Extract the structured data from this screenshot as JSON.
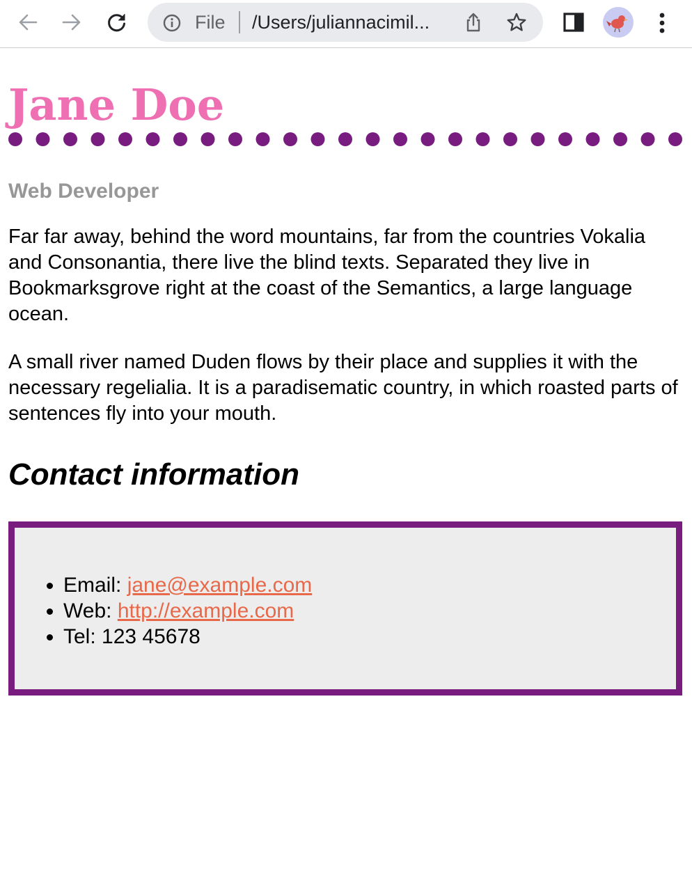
{
  "browser": {
    "file_label": "File",
    "url": "/Users/juliannacimil..."
  },
  "profile": {
    "name": "Jane Doe",
    "title": "Web Developer",
    "paragraphs": [
      "Far far away, behind the word mountains, far from the countries Vokalia and Consonantia, there live the blind texts. Separated they live in Bookmarksgrove right at the coast of the Semantics, a large language ocean.",
      "A small river named Duden flows by their place and supplies it with the necessary regelialia. It is a paradisematic country, in which roasted parts of sentences fly into your mouth."
    ]
  },
  "contact": {
    "heading": "Contact information",
    "email_label": "Email: ",
    "email": "jane@example.com",
    "web_label": "Web: ",
    "web": "http://example.com",
    "tel_label": "Tel: ",
    "tel": "123 45678"
  },
  "colors": {
    "name": "#ee6fb2",
    "accent_purple": "#781c80",
    "link": "#e8694a",
    "subtitle": "#979797",
    "contact_bg": "#ededed"
  },
  "icons": [
    "back-arrow-icon",
    "forward-arrow-icon",
    "reload-icon",
    "info-icon",
    "share-icon",
    "star-icon",
    "side-panel-icon",
    "avatar",
    "kebab-menu-icon"
  ]
}
